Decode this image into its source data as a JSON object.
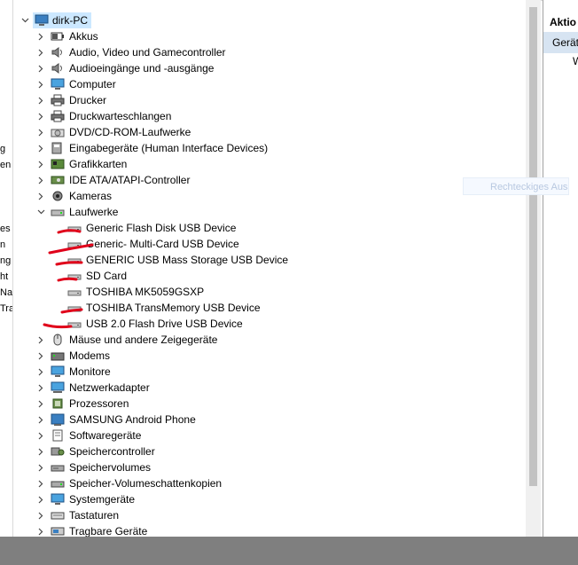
{
  "tree": {
    "root": "dirk-PC",
    "categories_before": [
      {
        "label": "Akkus",
        "icon": "battery-icon"
      },
      {
        "label": "Audio, Video und Gamecontroller",
        "icon": "speaker-icon"
      },
      {
        "label": "Audioeingänge und -ausgänge",
        "icon": "speaker-icon"
      },
      {
        "label": "Computer",
        "icon": "monitor-icon"
      },
      {
        "label": "Drucker",
        "icon": "printer-icon"
      },
      {
        "label": "Druckwarteschlangen",
        "icon": "printer-icon"
      },
      {
        "label": "DVD/CD-ROM-Laufwerke",
        "icon": "dvd-drive-icon"
      },
      {
        "label": "Eingabegeräte (Human Interface Devices)",
        "icon": "hid-icon"
      },
      {
        "label": "Grafikkarten",
        "icon": "display-adapter-icon"
      },
      {
        "label": "IDE ATA/ATAPI-Controller",
        "icon": "ide-controller-icon"
      },
      {
        "label": "Kameras",
        "icon": "camera-icon"
      }
    ],
    "expanded": {
      "label": "Laufwerke",
      "icon": "disk-drive-icon",
      "children": [
        "Generic Flash Disk USB Device",
        "Generic- Multi-Card USB Device",
        "GENERIC USB Mass Storage USB Device",
        "SD Card",
        "TOSHIBA MK5059GSXP",
        "TOSHIBA TransMemory USB Device",
        "USB 2.0 Flash Drive USB Device"
      ]
    },
    "categories_after": [
      {
        "label": "Mäuse und andere Zeigegeräte",
        "icon": "mouse-icon"
      },
      {
        "label": "Modems",
        "icon": "modem-icon"
      },
      {
        "label": "Monitore",
        "icon": "monitor-icon"
      },
      {
        "label": "Netzwerkadapter",
        "icon": "network-adapter-icon"
      },
      {
        "label": "Prozessoren",
        "icon": "processor-icon"
      },
      {
        "label": "SAMSUNG Android Phone",
        "icon": "phone-icon"
      },
      {
        "label": "Softwaregeräte",
        "icon": "software-device-icon"
      },
      {
        "label": "Speichercontroller",
        "icon": "storage-controller-icon"
      },
      {
        "label": "Speichervolumes",
        "icon": "storage-volume-icon"
      },
      {
        "label": "Speicher-Volumeschattenkopien",
        "icon": "shadow-copy-icon"
      },
      {
        "label": "Systemgeräte",
        "icon": "system-device-icon"
      },
      {
        "label": "Tastaturen",
        "icon": "keyboard-icon"
      },
      {
        "label": "Tragbare Geräte",
        "icon": "portable-device-icon"
      }
    ]
  },
  "actions_pane": {
    "header": "Aktio",
    "section": "Gerät",
    "item": "W"
  },
  "tooltip": "Rechteckiges Auss",
  "left_pane_fragments": [
    "g",
    "en",
    "es",
    "n",
    "ng",
    "ht",
    "Na",
    "Tra"
  ],
  "colors": {
    "selection": "#cce8ff",
    "annotation_red": "#e0001a",
    "bottom_bar": "#7f7f7f",
    "actions_subheader": "#d7e4f2"
  }
}
